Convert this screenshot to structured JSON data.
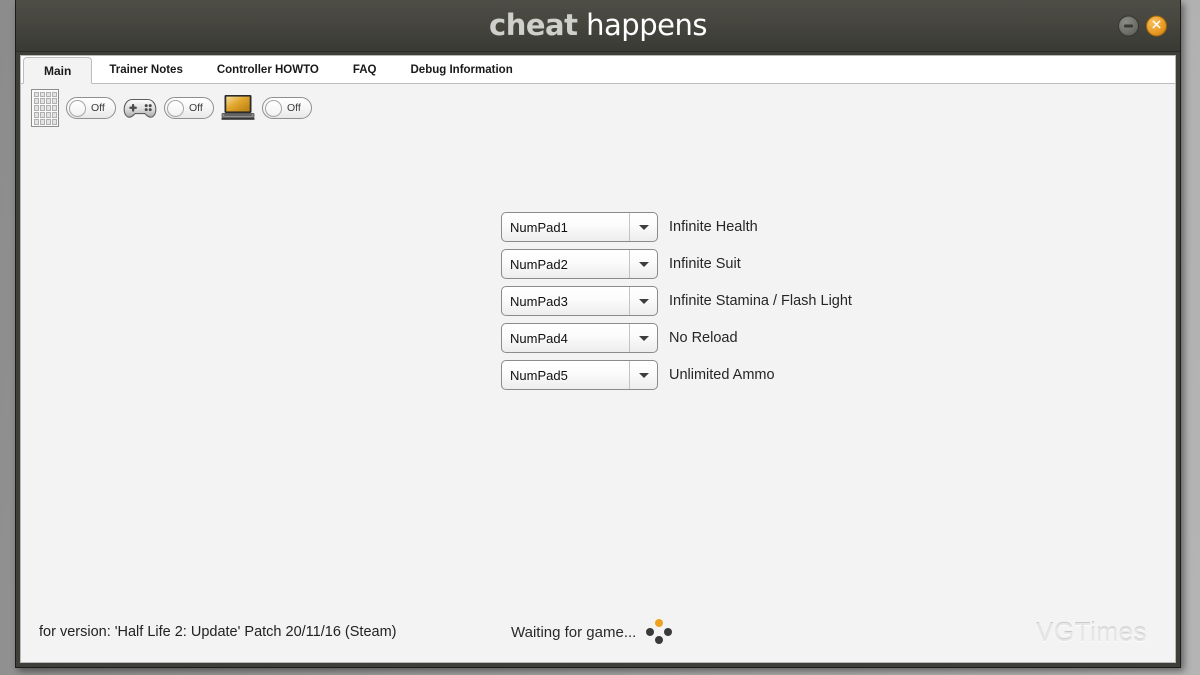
{
  "window": {
    "brand_first": "cheat",
    "brand_second": "happens",
    "minimize_label": "−",
    "close_label": "✕"
  },
  "tabs": [
    {
      "label": "Main",
      "active": true
    },
    {
      "label": "Trainer Notes",
      "active": false
    },
    {
      "label": "Controller HOWTO",
      "active": false
    },
    {
      "label": "FAQ",
      "active": false
    },
    {
      "label": "Debug Information",
      "active": false
    }
  ],
  "toolbar": {
    "items": [
      {
        "icon": "numpad-icon",
        "toggle_label": "Off",
        "toggle_state": "off"
      },
      {
        "icon": "gamepad-icon",
        "toggle_label": "Off",
        "toggle_state": "off"
      },
      {
        "icon": "laptop-icon",
        "toggle_label": "Off",
        "toggle_state": "off"
      }
    ]
  },
  "cheats": [
    {
      "hotkey": "NumPad1",
      "label": "Infinite Health"
    },
    {
      "hotkey": "NumPad2",
      "label": "Infinite Suit"
    },
    {
      "hotkey": "NumPad3",
      "label": "Infinite Stamina / Flash Light"
    },
    {
      "hotkey": "NumPad4",
      "label": "No Reload"
    },
    {
      "hotkey": "NumPad5",
      "label": "Unlimited Ammo"
    }
  ],
  "status": {
    "version_text": "for version: 'Half Life 2: Update' Patch 20/11/16 (Steam)",
    "waiting_text": "Waiting for game...",
    "watermark": "VGTimes"
  },
  "colors": {
    "titlebar": "#46463f",
    "accent_orange": "#eda221",
    "panel_bg": "#f4f3f3",
    "laptop_screen": "#d9a22c"
  }
}
